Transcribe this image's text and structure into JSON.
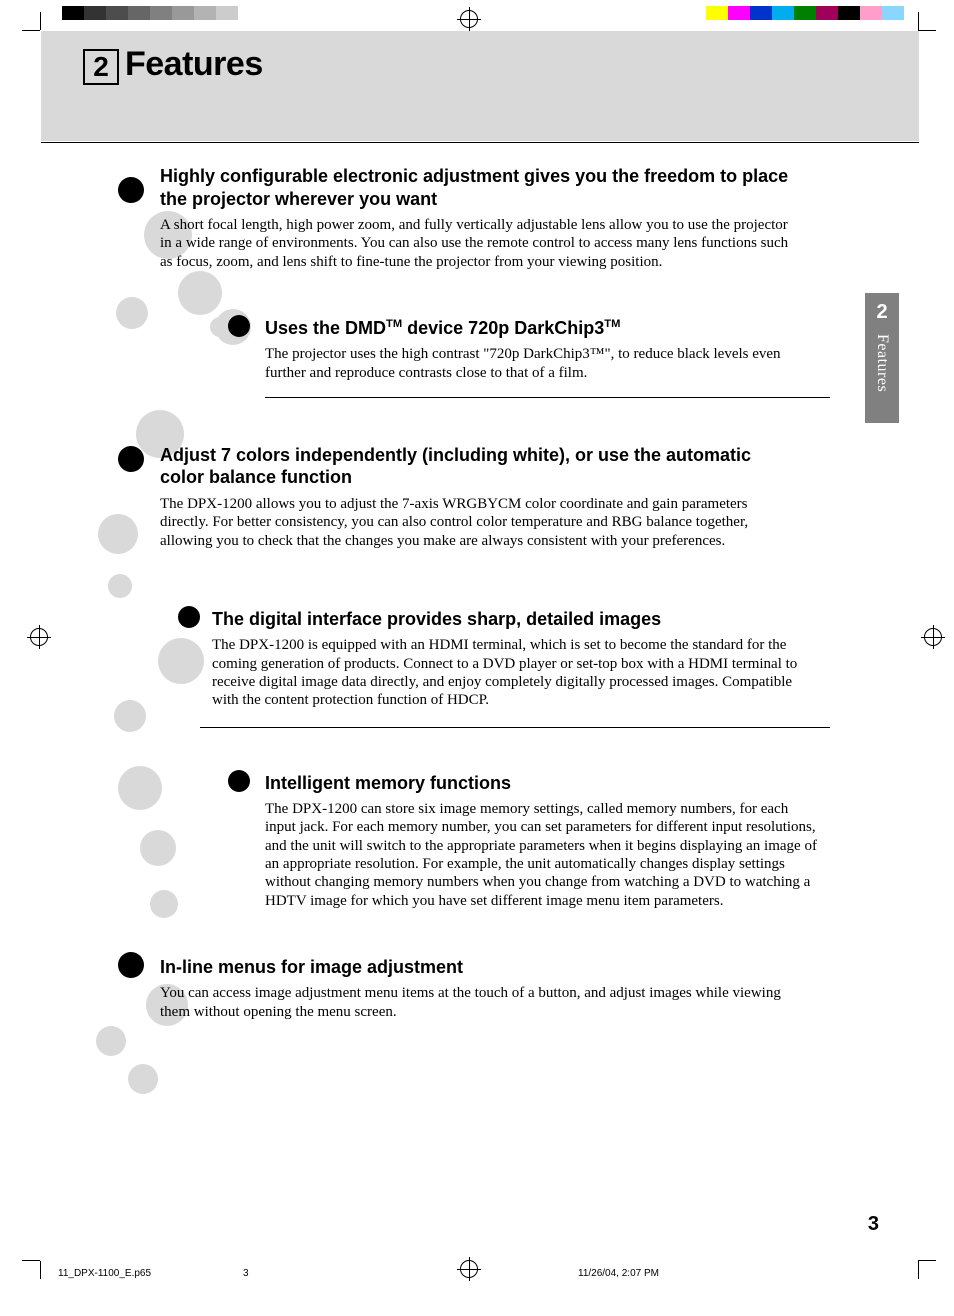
{
  "chapter": {
    "number": "2",
    "title": "Features"
  },
  "side_tab": {
    "number": "2",
    "label": "Features"
  },
  "page_number": "3",
  "footer": {
    "file": "11_DPX-1100_E.p65",
    "sheet": "3",
    "datetime": "11/26/04, 2:07 PM"
  },
  "sections": [
    {
      "heading": "Highly configurable electronic adjustment gives you the freedom to place the projector wherever you want",
      "body": "A short focal length, high power zoom, and fully vertically adjustable lens allow you to use the projector in a wide range of environments. You can also use the remote control to access many lens functions such as focus, zoom, and lens shift to fine-tune the projector from your viewing position."
    },
    {
      "heading_pre": "Uses the DMD",
      "heading_mid": " device 720p DarkChip3",
      "body": "The projector uses the high contrast \"720p DarkChip3™\", to reduce black levels even further and reproduce contrasts close to that of a film."
    },
    {
      "heading": "Adjust 7 colors independently (including white), or use the automatic color balance function",
      "body": "The DPX-1200 allows you to adjust the 7-axis WRGBYCM color coordinate and gain parameters directly. For better consistency, you can also control color temperature and RBG balance together, allowing you to check that the changes you make are always consistent with your preferences."
    },
    {
      "heading": "The digital interface provides sharp, detailed images",
      "body": "The DPX-1200 is equipped with an HDMI terminal, which is set to become the standard for the coming generation of products. Connect to a DVD player or set-top box with a HDMI terminal to receive digital image data directly, and enjoy completely digitally processed images. Compatible with the content protection function of HDCP."
    },
    {
      "heading": "Intelligent memory functions",
      "body": "The DPX-1200 can store six image memory settings, called memory numbers, for each input jack. For each memory number, you can set parameters for different input resolutions, and the unit will switch to the appropriate parameters when it begins displaying an image of an appropriate resolution. For example, the unit automatically changes display settings without changing memory numbers when you change from watching a DVD to watching a HDTV image for which you have set different image menu item parameters."
    },
    {
      "heading": "In-line menus for image adjustment",
      "body": "You can access image adjustment menu items at the touch of a button, and adjust images while viewing them without opening the menu screen."
    }
  ],
  "calibration": {
    "greys": [
      "#000000",
      "#333333",
      "#4d4d4d",
      "#666666",
      "#808080",
      "#999999",
      "#b3b3b3",
      "#cccccc",
      "#ffffff",
      "#ffffff"
    ],
    "colors": [
      "#ffffff",
      "#ffff00",
      "#ff00ff",
      "#0033cc",
      "#00aeef",
      "#008000",
      "#a0005a",
      "#000000",
      "#ff9ecb",
      "#8bd6ff"
    ]
  }
}
